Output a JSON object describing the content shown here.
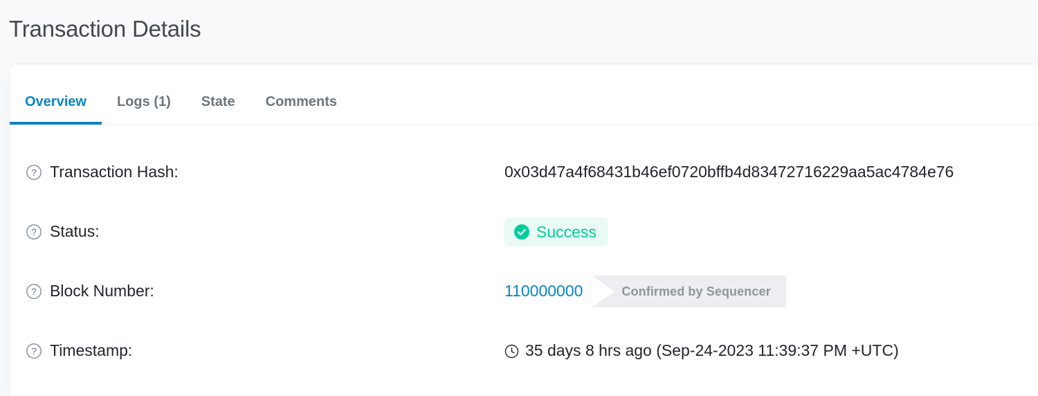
{
  "header": {
    "title": "Transaction Details"
  },
  "tabs": [
    {
      "id": "overview",
      "label": "Overview",
      "active": true
    },
    {
      "id": "logs",
      "label": "Logs (1)",
      "active": false
    },
    {
      "id": "state",
      "label": "State",
      "active": false
    },
    {
      "id": "comments",
      "label": "Comments",
      "active": false
    }
  ],
  "rows": {
    "transaction_hash": {
      "label": "Transaction Hash:",
      "value": "0x03d47a4f68431b46ef0720bffb4d83472716229aa5ac4784e76",
      "help_icon": "question-circle-icon"
    },
    "status": {
      "label": "Status:",
      "badge_text": "Success",
      "badge_icon": "check-circle-icon",
      "badge_bg": "#e9fbf4",
      "badge_color": "#00cc9b",
      "help_icon": "question-circle-icon"
    },
    "block_number": {
      "label": "Block Number:",
      "value": "110000000",
      "value_color": "#0784c3",
      "banner_text": "Confirmed by Sequencer",
      "banner_bg": "#eceef1",
      "banner_color": "#8e959d",
      "help_icon": "question-circle-icon"
    },
    "timestamp": {
      "label": "Timestamp:",
      "value": "35 days 8 hrs ago (Sep-24-2023 11:39:37 PM +UTC)",
      "icon": "clock-icon",
      "help_icon": "question-circle-icon"
    }
  },
  "colors": {
    "accent": "#0784c3",
    "success": "#00cc9b",
    "page_bg": "#f8f9fb",
    "card_bg": "#ffffff",
    "title": "#41494f",
    "muted": "#6c757d"
  }
}
